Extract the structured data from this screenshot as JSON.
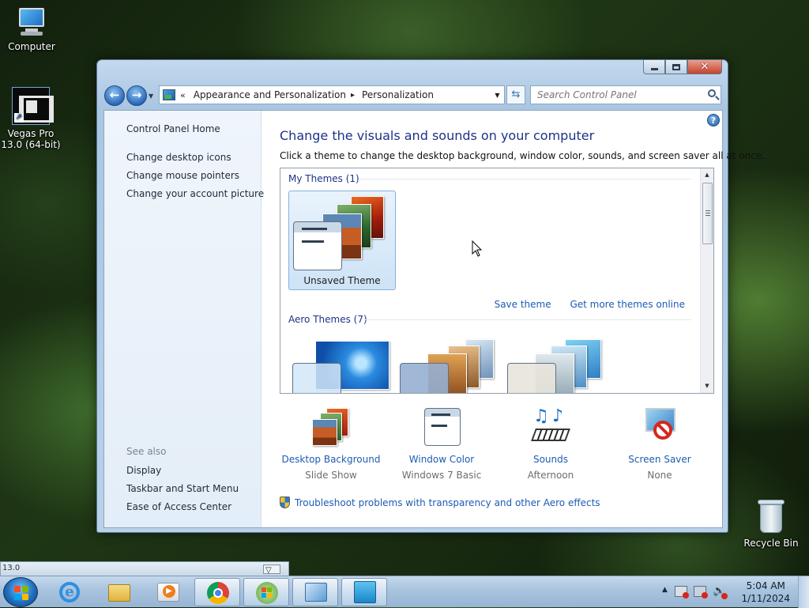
{
  "desktop": {
    "icons": [
      {
        "label": "Computer"
      },
      {
        "label": "Vegas Pro 13.0 (64-bit)"
      },
      {
        "label": "Recycle Bin"
      }
    ]
  },
  "window": {
    "address": {
      "overflow": "«",
      "crumbs": [
        "Appearance and Personalization",
        "Personalization"
      ],
      "separator": "▸"
    },
    "search": {
      "placeholder": "Search Control Panel"
    },
    "left_pane": {
      "home": "Control Panel Home",
      "tasks": [
        "Change desktop icons",
        "Change mouse pointers",
        "Change your account picture"
      ],
      "see_also_heading": "See also",
      "see_also": [
        "Display",
        "Taskbar and Start Menu",
        "Ease of Access Center"
      ]
    },
    "main": {
      "title": "Change the visuals and sounds on your computer",
      "subtitle": "Click a theme to change the desktop background, window color, sounds, and screen saver all at once.",
      "groups": {
        "my_themes": "My Themes (1)",
        "aero_themes": "Aero Themes (7)"
      },
      "selected_theme": "Unsaved Theme",
      "save_theme": "Save theme",
      "more_themes": "Get more themes online",
      "settings": [
        {
          "label": "Desktop Background",
          "value": "Slide Show"
        },
        {
          "label": "Window Color",
          "value": "Windows 7 Basic"
        },
        {
          "label": "Sounds",
          "value": "Afternoon"
        },
        {
          "label": "Screen Saver",
          "value": "None"
        }
      ],
      "troubleshoot": "Troubleshoot problems with transparency and other Aero effects"
    }
  },
  "taskbar": {
    "peek_label": "13.0",
    "clock": {
      "time": "5:04 AM",
      "date": "1/11/2024"
    }
  },
  "colors": {
    "link": "#1e5bb3",
    "heading": "#1e3287",
    "selection": "#cde3f7"
  }
}
